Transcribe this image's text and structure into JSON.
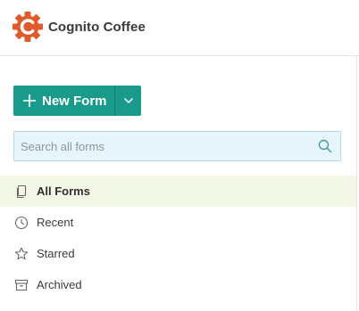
{
  "brand": {
    "name": "Cognito Coffee",
    "logo_icon": "cog-c-logo-icon",
    "logo_color": "#e05a2b"
  },
  "toolbar": {
    "new_form_label": "New Form",
    "accent": "#1a9a8a"
  },
  "search": {
    "placeholder": "Search all forms",
    "value": ""
  },
  "nav": {
    "items": [
      {
        "label": "All Forms",
        "icon": "copy-icon",
        "active": true
      },
      {
        "label": "Recent",
        "icon": "clock-icon",
        "active": false
      },
      {
        "label": "Starred",
        "icon": "star-icon",
        "active": false
      },
      {
        "label": "Archived",
        "icon": "archive-icon",
        "active": false
      }
    ]
  }
}
